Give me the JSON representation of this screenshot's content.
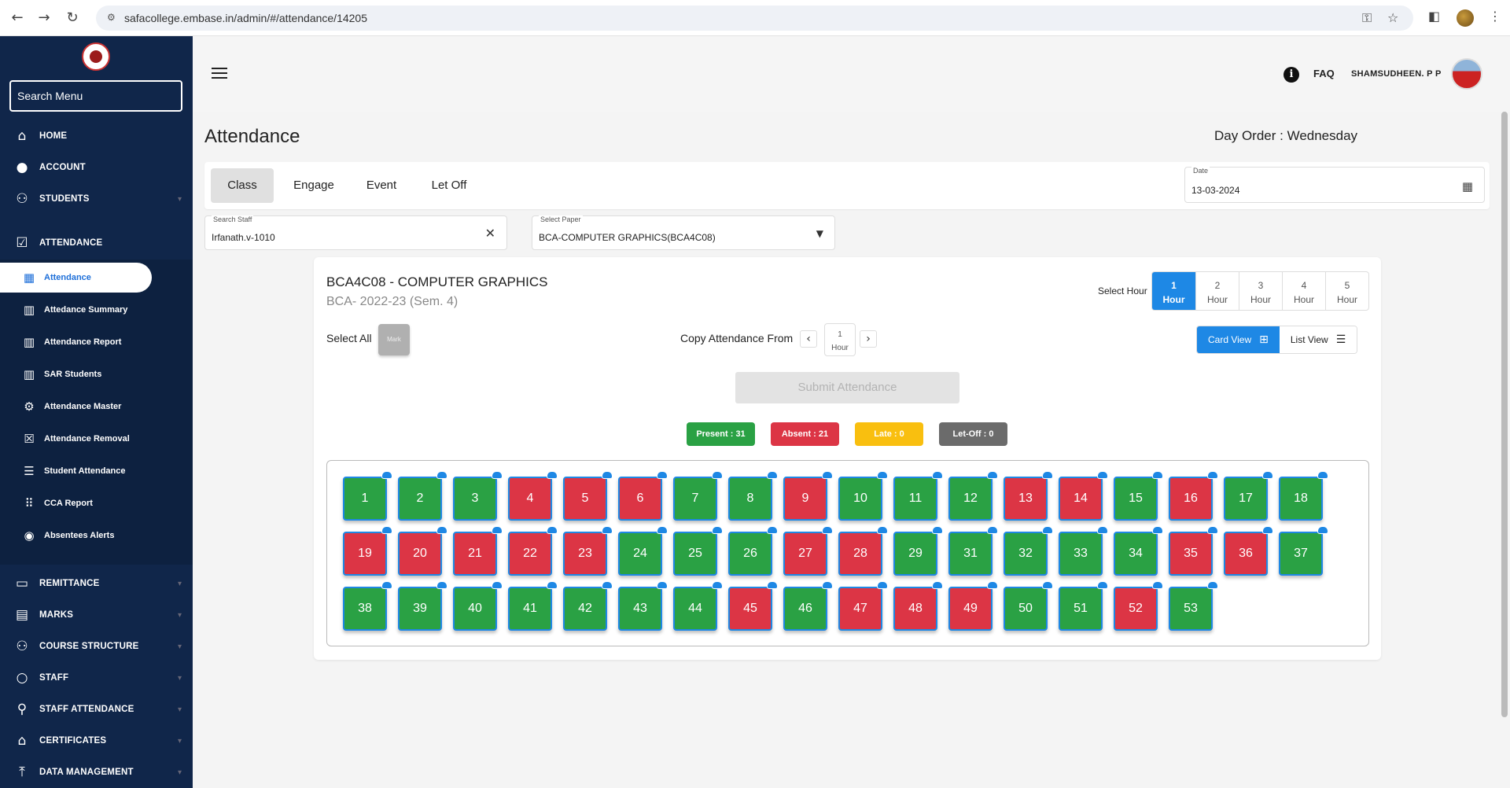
{
  "browser": {
    "url": "safacollege.embase.in/admin/#/attendance/14205"
  },
  "sidebar": {
    "search_placeholder": "Search Menu",
    "items": [
      {
        "label": "HOME",
        "icon": "home-icon",
        "glyph": "⌂"
      },
      {
        "label": "ACCOUNT",
        "icon": "person-icon",
        "glyph": "●"
      },
      {
        "label": "STUDENTS",
        "icon": "group-icon",
        "glyph": "⚇"
      },
      {
        "label": "ATTENDANCE",
        "icon": "clipboard-check-icon",
        "glyph": "☑"
      },
      {
        "label": "REMITTANCE",
        "icon": "card-icon",
        "glyph": "▭"
      },
      {
        "label": "MARKS",
        "icon": "clipboard-icon",
        "glyph": "▤"
      },
      {
        "label": "COURSE STRUCTURE",
        "icon": "group-add-icon",
        "glyph": "⚇"
      },
      {
        "label": "STAFF",
        "icon": "person-outline-icon",
        "glyph": "○"
      },
      {
        "label": "STAFF ATTENDANCE",
        "icon": "walk-icon",
        "glyph": "⚲"
      },
      {
        "label": "CERTIFICATES",
        "icon": "school-icon",
        "glyph": "⌂"
      },
      {
        "label": "DATA MANAGEMENT",
        "icon": "upload-icon",
        "glyph": "⤒"
      }
    ],
    "attendance_sub": [
      {
        "label": "Attendance",
        "icon": "calendar-icon",
        "glyph": "▦"
      },
      {
        "label": "Attedance Summary",
        "icon": "bar-chart-icon",
        "glyph": "▥"
      },
      {
        "label": "Attendance Report",
        "icon": "bar-chart-icon",
        "glyph": "▥"
      },
      {
        "label": "SAR Students",
        "icon": "bar-chart-icon",
        "glyph": "▥"
      },
      {
        "label": "Attendance Master",
        "icon": "gear-icon",
        "glyph": "⚙"
      },
      {
        "label": "Attendance Removal",
        "icon": "delete-calendar-icon",
        "glyph": "☒"
      },
      {
        "label": "Student Attendance",
        "icon": "list-icon",
        "glyph": "☰"
      },
      {
        "label": "CCA Report",
        "icon": "dots-grid-icon",
        "glyph": "⠿"
      },
      {
        "label": "Absentees Alerts",
        "icon": "alarm-icon",
        "glyph": "◉"
      }
    ]
  },
  "header": {
    "faq": "FAQ",
    "user": "SHAMSUDHEEN. P P",
    "info_icon": "i"
  },
  "page": {
    "title": "Attendance",
    "day_order": "Day Order : Wednesday",
    "tabs": [
      "Class",
      "Engage",
      "Event",
      "Let Off"
    ],
    "active_tab": "Class",
    "date_label": "Date",
    "date_value": "13-03-2024",
    "staff_label": "Search Staff",
    "staff_value": "Irfanath.v-1010",
    "paper_label": "Select Paper",
    "paper_value": "BCA-COMPUTER GRAPHICS(BCA4C08)"
  },
  "card": {
    "course_title": "BCA4C08 - COMPUTER GRAPHICS",
    "course_sub": "BCA- 2022-23 (Sem. 4)",
    "select_hour_label": "Select Hour",
    "hours": [
      {
        "num": "1",
        "label": "Hour",
        "active": true
      },
      {
        "num": "2",
        "label": "Hour",
        "active": false
      },
      {
        "num": "3",
        "label": "Hour",
        "active": false
      },
      {
        "num": "4",
        "label": "Hour",
        "active": false
      },
      {
        "num": "5",
        "label": "Hour",
        "active": false
      }
    ],
    "select_all": "Select All",
    "mark": "Mark",
    "copy_from": "Copy Attendance From",
    "copy_hour_num": "1",
    "copy_hour_label": "Hour",
    "card_view": "Card View",
    "list_view": "List View",
    "submit": "Submit Attendance",
    "stats": {
      "present": "Present : 31",
      "absent": "Absent : 21",
      "late": "Late : 0",
      "letoff": "Let-Off : 0"
    },
    "colors": {
      "present": "#2aa144",
      "absent": "#dc3545",
      "late": "#f9bf0f",
      "letoff": "#6b6b6b",
      "accent": "#1e88e5"
    },
    "students": [
      {
        "roll": "1",
        "status": "present"
      },
      {
        "roll": "2",
        "status": "present"
      },
      {
        "roll": "3",
        "status": "present"
      },
      {
        "roll": "4",
        "status": "absent"
      },
      {
        "roll": "5",
        "status": "absent"
      },
      {
        "roll": "6",
        "status": "absent"
      },
      {
        "roll": "7",
        "status": "present"
      },
      {
        "roll": "8",
        "status": "present"
      },
      {
        "roll": "9",
        "status": "absent"
      },
      {
        "roll": "10",
        "status": "present"
      },
      {
        "roll": "11",
        "status": "present"
      },
      {
        "roll": "12",
        "status": "present"
      },
      {
        "roll": "13",
        "status": "absent"
      },
      {
        "roll": "14",
        "status": "absent"
      },
      {
        "roll": "15",
        "status": "present"
      },
      {
        "roll": "16",
        "status": "absent"
      },
      {
        "roll": "17",
        "status": "present"
      },
      {
        "roll": "18",
        "status": "present"
      },
      {
        "roll": "19",
        "status": "absent"
      },
      {
        "roll": "20",
        "status": "absent"
      },
      {
        "roll": "21",
        "status": "absent"
      },
      {
        "roll": "22",
        "status": "absent"
      },
      {
        "roll": "23",
        "status": "absent"
      },
      {
        "roll": "24",
        "status": "present"
      },
      {
        "roll": "25",
        "status": "present"
      },
      {
        "roll": "26",
        "status": "present"
      },
      {
        "roll": "27",
        "status": "absent"
      },
      {
        "roll": "28",
        "status": "absent"
      },
      {
        "roll": "29",
        "status": "present"
      },
      {
        "roll": "31",
        "status": "present"
      },
      {
        "roll": "32",
        "status": "present"
      },
      {
        "roll": "33",
        "status": "present"
      },
      {
        "roll": "34",
        "status": "present"
      },
      {
        "roll": "35",
        "status": "absent"
      },
      {
        "roll": "36",
        "status": "absent"
      },
      {
        "roll": "37",
        "status": "present"
      },
      {
        "roll": "38",
        "status": "present"
      },
      {
        "roll": "39",
        "status": "present"
      },
      {
        "roll": "40",
        "status": "present"
      },
      {
        "roll": "41",
        "status": "present"
      },
      {
        "roll": "42",
        "status": "present"
      },
      {
        "roll": "43",
        "status": "present"
      },
      {
        "roll": "44",
        "status": "present"
      },
      {
        "roll": "45",
        "status": "absent"
      },
      {
        "roll": "46",
        "status": "present"
      },
      {
        "roll": "47",
        "status": "absent"
      },
      {
        "roll": "48",
        "status": "absent"
      },
      {
        "roll": "49",
        "status": "absent"
      },
      {
        "roll": "50",
        "status": "present"
      },
      {
        "roll": "51",
        "status": "present"
      },
      {
        "roll": "52",
        "status": "absent"
      },
      {
        "roll": "53",
        "status": "present"
      }
    ]
  }
}
